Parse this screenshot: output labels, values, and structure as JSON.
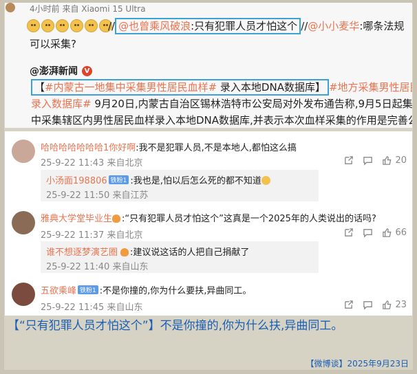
{
  "post": {
    "meta": "4小时前 来自 Xiaomi 15 Ultra",
    "slashes": "//",
    "mention1": "@也曾乘风破浪",
    "quote1": ":只有犯罪人员才怕这个",
    "slash2": "//",
    "mention2": "@小小麦华",
    "question": ":哪条法规",
    "question2": "可以采集?",
    "source_name": "@澎湃新闻",
    "verified": "V",
    "news_open": "【",
    "news_topic": "#内蒙古一地集中采集男性居民血样#",
    "news_title": " 录入本地DNA数据库",
    "news_close": "】",
    "news_topic2a": "#地方采集男性居民血样",
    "news_topic2b": "录入数据库#",
    "news_body1": " 9月20日,内蒙古自治区锡林浩特市公安局对外发布通告称,9月5日起集",
    "news_body2": "中采集辖区内男性居民血样录入本地DNA数据库,并表示本次血样采集的作用是完善公"
  },
  "comments": [
    {
      "name": "哈哈哈哈哈哈哈1你好啊",
      "text": ":我不是犯罪人员,不是本地人,都怕这么搞",
      "time": "25-9-22 11:43 来自北京",
      "likes": "20",
      "reply": {
        "name": "小汤面198806",
        "badge": "铁粉1",
        "text": ":我也是,怕以后怎么死的都不知道",
        "time": "25-9-22 11:50 来自江苏"
      }
    },
    {
      "name": "雅典大学堂毕业生",
      "text": ":“只有犯罪人员才怕这个”这真是一个2025年的人类说出的话吗?",
      "time": "25-9-22 11:37 来自北京",
      "likes": "66",
      "reply": {
        "name": "谁不想逐梦演艺圈",
        "text": ":建议说这话的人把自己捐献了",
        "time": "25-9-22 11:40 来自山东"
      }
    },
    {
      "name": "五欲乘峰",
      "badge": "铁粉1",
      "text": ":不是你撞的,你为什么要扶,异曲同工。",
      "time": "25-9-22 11:45 来自山东",
      "likes": "23"
    }
  ],
  "caption": "【“只有犯罪人员才怕这个”】不是你撞的,你为什么扶,异曲同工。",
  "footer": "【微博谈】2025年9月23日",
  "icons": [
    "share-icon",
    "comment-icon",
    "like-icon"
  ],
  "colors": {
    "mention": "#eb7350",
    "highlight_box": "#3aa2d6",
    "caption": "#1a5fb4"
  }
}
